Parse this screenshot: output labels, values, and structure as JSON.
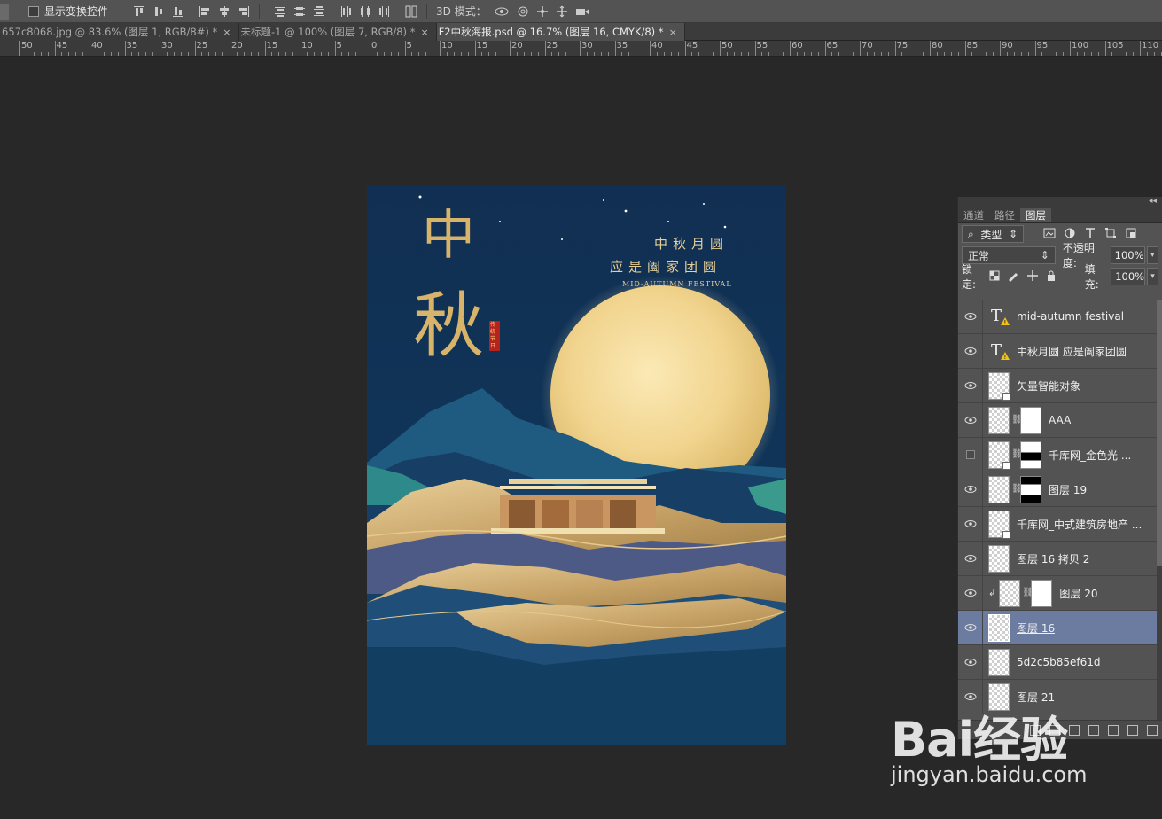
{
  "options_bar": {
    "show_transform_controls": "显示变换控件",
    "mode_3d_label": "3D 模式："
  },
  "tabs": [
    {
      "label": "657c8068.jpg @ 83.6% (图层 1, RGB/8#) *",
      "active": false
    },
    {
      "label": "未标题-1 @ 100% (图层 7, RGB/8) *",
      "active": false
    },
    {
      "label": "F2中秋海报.psd @ 16.7% (图层 16, CMYK/8) *",
      "active": true
    }
  ],
  "ruler_ticks": [
    "50",
    "45",
    "40",
    "35",
    "30",
    "25",
    "20",
    "15",
    "10",
    "5",
    "0",
    "5",
    "10",
    "15",
    "20",
    "25",
    "30",
    "35",
    "40",
    "45",
    "50",
    "55",
    "60",
    "65",
    "70",
    "75",
    "80",
    "85",
    "90",
    "95",
    "100",
    "105",
    "110"
  ],
  "poster": {
    "title_char1": "中",
    "title_char2": "秋",
    "seal_text": "传统节日",
    "slogan_line1": "中秋月圆",
    "slogan_line2": "应是阖家团圆",
    "subtitle": "MID-AUTUMN FESTIVAL"
  },
  "layers_panel": {
    "tabs": [
      "通道",
      "路径",
      "图层"
    ],
    "active_tab": "图层",
    "filter_kind": "类型",
    "blend_mode": "正常",
    "opacity_label": "不透明度:",
    "opacity_value": "100%",
    "lock_label": "锁定:",
    "fill_label": "填充:",
    "fill_value": "100%",
    "layers": [
      {
        "name": "mid-autumn festival",
        "kind": "type",
        "visible": true
      },
      {
        "name": "中秋月圆 应是阖家团圆",
        "kind": "type",
        "visible": true
      },
      {
        "name": "矢量智能对象",
        "kind": "smart",
        "visible": true
      },
      {
        "name": "AAA",
        "kind": "masked",
        "visible": true
      },
      {
        "name": "千库网_金色光 ...",
        "kind": "masked",
        "visible": false
      },
      {
        "name": "图层 19",
        "kind": "masked",
        "visible": true
      },
      {
        "name": "千库网_中式建筑房地产 ...",
        "kind": "smart",
        "visible": true
      },
      {
        "name": "图层 16 拷贝 2",
        "kind": "pixel",
        "visible": true
      },
      {
        "name": "图层 20",
        "kind": "clipped-masked",
        "visible": true
      },
      {
        "name": "图层 16",
        "kind": "pixel",
        "visible": true,
        "selected": true
      },
      {
        "name": "5d2c5b85ef61d",
        "kind": "pixel",
        "visible": true
      },
      {
        "name": "图层 21",
        "kind": "pixel",
        "visible": true
      }
    ]
  },
  "watermark": {
    "logo": "Bai经验",
    "url": "jingyan.baidu.com"
  }
}
